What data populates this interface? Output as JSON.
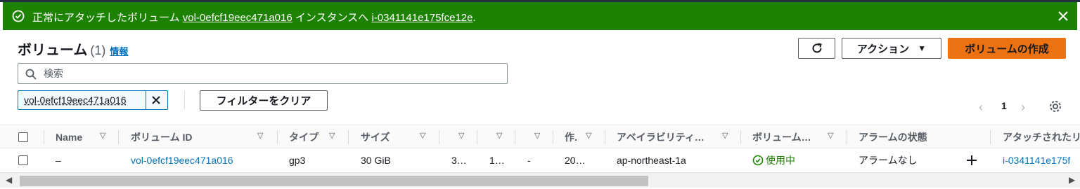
{
  "flash": {
    "prefix": "正常にアタッチしたボリューム ",
    "volume_link": "vol-0efcf19eec471a016",
    "middle": " インスタンスへ ",
    "instance_link": "i-0341141e175fce12e",
    "suffix": ".",
    "bg_color": "#1d8102"
  },
  "header": {
    "title": "ボリューム",
    "count": "(1)",
    "info": "情報",
    "actions_label": "アクション",
    "create_label": "ボリュームの作成"
  },
  "search": {
    "placeholder": "検索"
  },
  "filter": {
    "token": "vol-0efcf19eec471a016",
    "clear_label": "フィルターをクリア"
  },
  "pagination": {
    "page": "1"
  },
  "columns": [
    "Name",
    "ボリューム ID",
    "タイプ",
    "サイズ",
    "",
    "",
    "",
    "作.",
    "アベイラビリティ…",
    "ボリューム…",
    "アラームの状態",
    "アタッチされたリ"
  ],
  "rows": [
    {
      "name": "–",
      "volume_id": "vol-0efcf19eec471a016",
      "type": "gp3",
      "size": "30 GiB",
      "c5": "3…",
      "c6": "1…",
      "c7": "-",
      "created": "20…",
      "az": "ap-northeast-1a",
      "state": "使用中",
      "alarm": "アラームなし",
      "attached": "i-0341141e175f"
    }
  ],
  "colors": {
    "accent": "#ec7211",
    "link": "#0073bb",
    "success": "#1d8102"
  }
}
